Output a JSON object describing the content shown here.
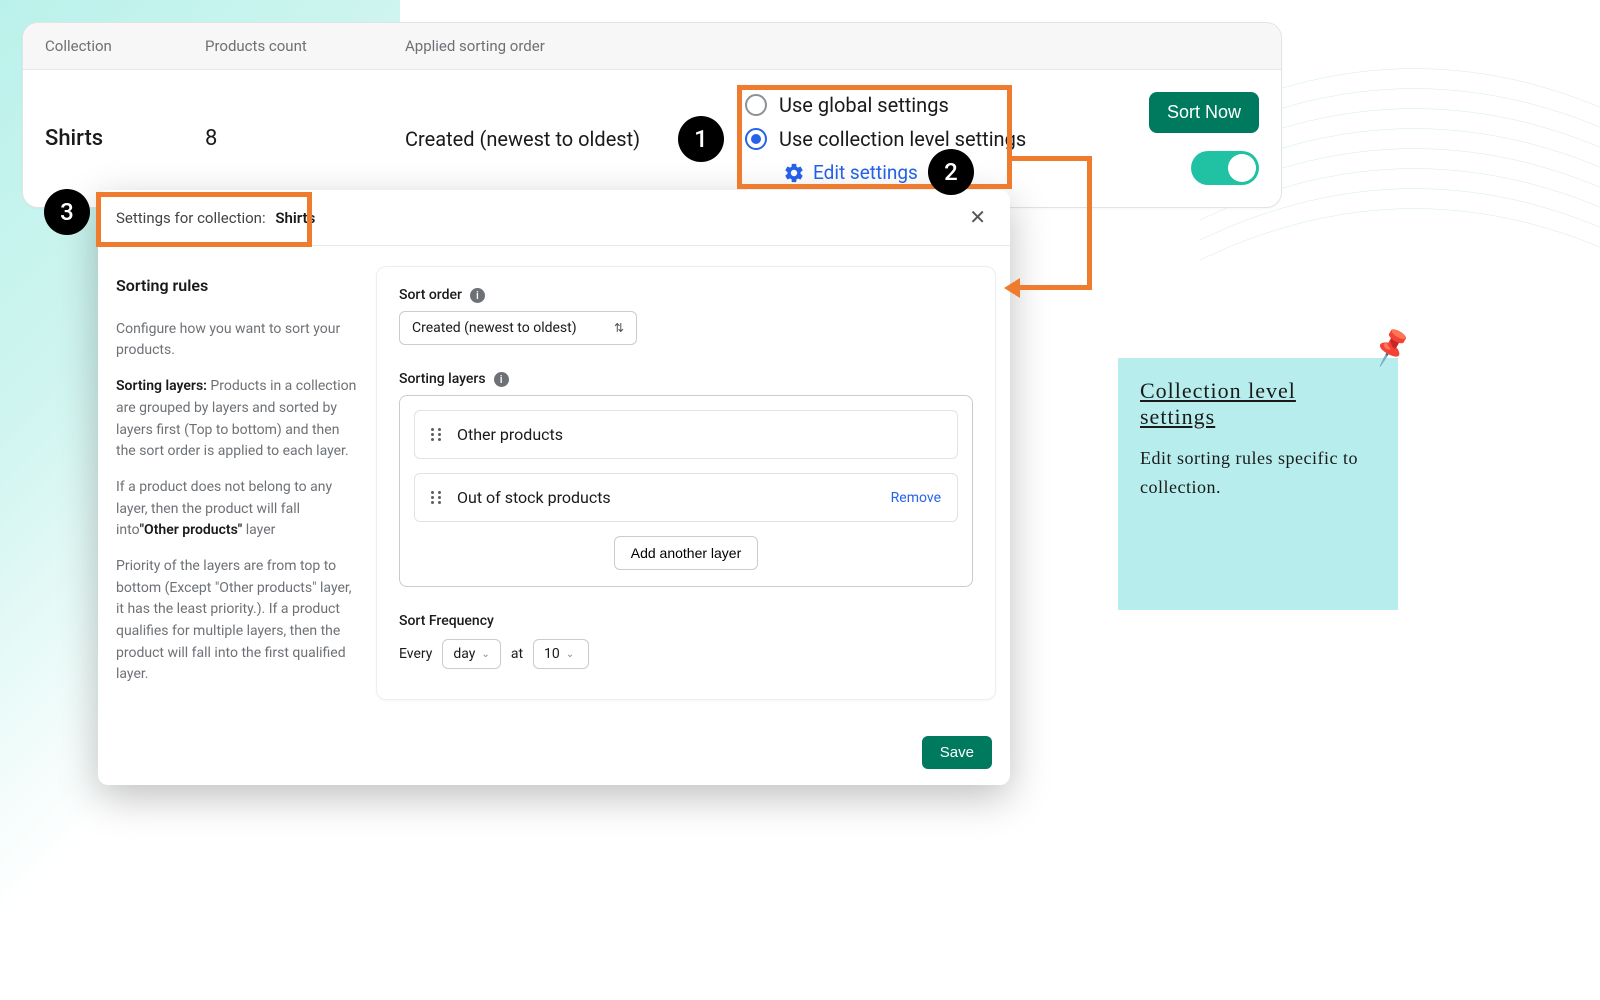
{
  "table": {
    "headers": {
      "collection": "Collection",
      "count": "Products count",
      "sort": "Applied sorting order"
    },
    "row": {
      "collection": "Shirts",
      "count": "8",
      "sort": "Created (newest to oldest)"
    }
  },
  "settings_radio": {
    "global": "Use global settings",
    "collection": "Use collection level settings",
    "edit": "Edit settings"
  },
  "actions": {
    "sort_now": "Sort Now"
  },
  "modal": {
    "title_label": "Settings for collection:",
    "title_value": "Shirts",
    "left": {
      "heading": "Sorting rules",
      "p1": "Configure how you want to sort your products.",
      "p2a": "Sorting layers:",
      "p2b": " Products in a collection are grouped by layers and sorted by layers first (Top to bottom) and then the sort order is applied to each layer.",
      "p3a": "If a product does not belong to any layer, then the product will fall into",
      "p3b": "\"Other products\"",
      "p3c": " layer",
      "p4": "Priority of the layers are from top to bottom (Except \"Other products\" layer, it has the least priority.). If a product qualifies for multiple layers, then the product will fall into the first qualified layer."
    },
    "right": {
      "sort_order_label": "Sort order",
      "sort_order_value": "Created (newest to oldest)",
      "layers_label": "Sorting layers",
      "layer1": "Other products",
      "layer2": "Out of stock products",
      "remove": "Remove",
      "add_layer": "Add another layer",
      "freq_label": "Sort Frequency",
      "freq_every": "Every",
      "freq_unit": "day",
      "freq_at": "at",
      "freq_hour": "10"
    },
    "save": "Save"
  },
  "badges": {
    "one": "1",
    "two": "2",
    "three": "3"
  },
  "sticky": {
    "title": "Collection level settings",
    "body": "Edit sorting rules specific to collection."
  }
}
